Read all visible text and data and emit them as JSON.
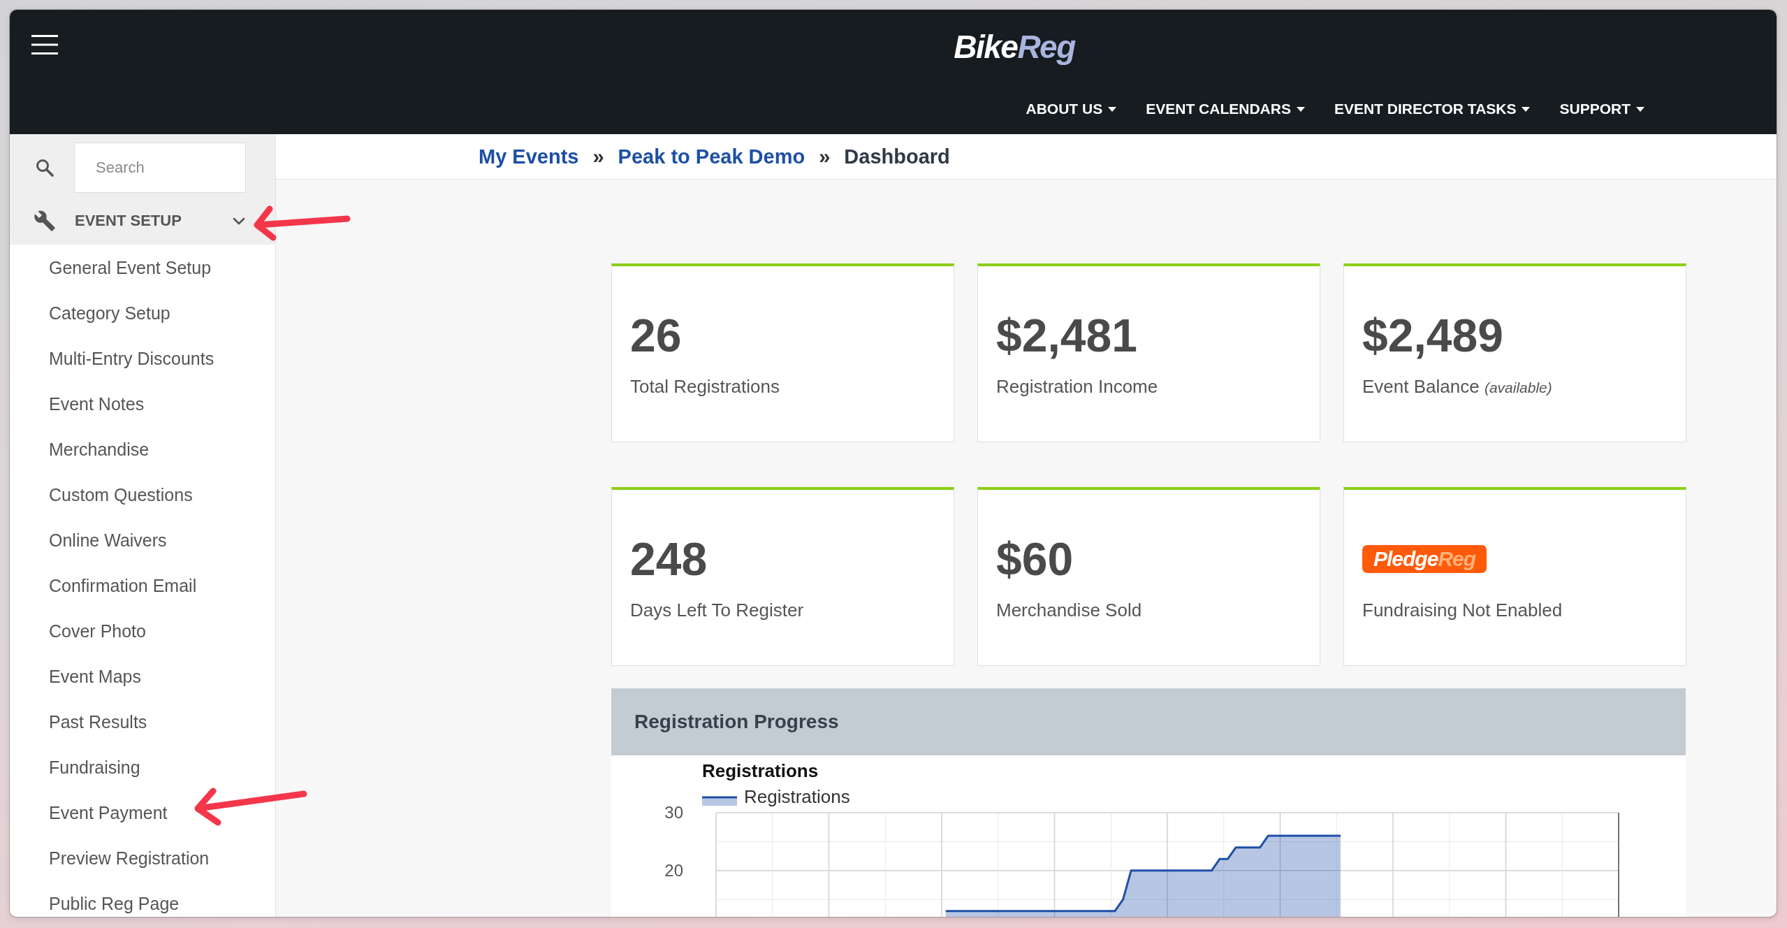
{
  "header": {
    "logo": {
      "lead": "Bike",
      "tail": "Reg"
    },
    "nav": [
      {
        "label": "ABOUT US"
      },
      {
        "label": "EVENT CALENDARS"
      },
      {
        "label": "EVENT DIRECTOR TASKS"
      },
      {
        "label": "SUPPORT"
      }
    ]
  },
  "sidebar": {
    "search": {
      "placeholder": "Search"
    },
    "section": {
      "label": "EVENT SETUP",
      "expanded": true,
      "annotated": true,
      "items": [
        {
          "label": "General Event Setup",
          "annotated": false
        },
        {
          "label": "Category Setup",
          "annotated": false
        },
        {
          "label": "Multi-Entry Discounts",
          "annotated": false
        },
        {
          "label": "Event Notes",
          "annotated": false
        },
        {
          "label": "Merchandise",
          "annotated": false
        },
        {
          "label": "Custom Questions",
          "annotated": false
        },
        {
          "label": "Online Waivers",
          "annotated": false
        },
        {
          "label": "Confirmation Email",
          "annotated": false
        },
        {
          "label": "Cover Photo",
          "annotated": false
        },
        {
          "label": "Event Maps",
          "annotated": false
        },
        {
          "label": "Past Results",
          "annotated": false
        },
        {
          "label": "Fundraising",
          "annotated": false
        },
        {
          "label": "Event Payment",
          "annotated": true
        },
        {
          "label": "Preview Registration",
          "annotated": false
        },
        {
          "label": "Public Reg Page",
          "annotated": false
        }
      ]
    }
  },
  "breadcrumbs": [
    {
      "kind": "link",
      "label": "My Events"
    },
    {
      "kind": "separator",
      "label": "»"
    },
    {
      "kind": "link",
      "label": "Peak to Peak Demo"
    },
    {
      "kind": "separator",
      "label": "»"
    },
    {
      "kind": "current",
      "label": "Dashboard"
    }
  ],
  "cards": [
    {
      "kind": "stat",
      "value": "26",
      "label": "Total Registrations"
    },
    {
      "kind": "stat",
      "value": "$2,481",
      "label": "Registration Income"
    },
    {
      "kind": "stat",
      "value": "$2,489",
      "label": "Event Balance *(available)*"
    },
    {
      "kind": "stat",
      "value": "248",
      "label": "Days Left To Register"
    },
    {
      "kind": "stat",
      "value": "$60",
      "label": "Merchandise Sold"
    },
    {
      "kind": "logo",
      "logo": {
        "lead": "Pledge",
        "tail": "Reg"
      },
      "label": "Fundraising Not Enabled"
    }
  ],
  "progress_panel": {
    "title": "Registration Progress",
    "chart_data": {
      "type": "area",
      "title": "Registrations",
      "categories": [
        null,
        null,
        null,
        null,
        null,
        null,
        null,
        null,
        null,
        null,
        null,
        null,
        null,
        null,
        null,
        null,
        null,
        null,
        null,
        null,
        null,
        null,
        null,
        null,
        null,
        null,
        null,
        null,
        null,
        null,
        null,
        null,
        null,
        null,
        null,
        null,
        null,
        null,
        null,
        null,
        null,
        null,
        null,
        null,
        null,
        null,
        null,
        null,
        null,
        null,
        null,
        null,
        null,
        null,
        null,
        null,
        null,
        null,
        null,
        null,
        null,
        null,
        null,
        null,
        null,
        null,
        null,
        null,
        null,
        null,
        null,
        null,
        null,
        null,
        null,
        null,
        null,
        null,
        null,
        null,
        null,
        null,
        null,
        null,
        null,
        null,
        null,
        null,
        null,
        null,
        null,
        null,
        null,
        null,
        null,
        null,
        null,
        null,
        null,
        null,
        null,
        null,
        null,
        null,
        null,
        null,
        null,
        null,
        null,
        null,
        null,
        null
      ],
      "series": [
        {
          "name": "Registrations",
          "color": "#1f4fa8",
          "values": [
            null,
            null,
            null,
            null,
            null,
            null,
            null,
            null,
            null,
            null,
            null,
            null,
            null,
            null,
            null,
            null,
            null,
            null,
            null,
            null,
            null,
            null,
            null,
            null,
            null,
            null,
            null,
            null,
            13,
            13,
            13,
            13,
            13,
            13,
            13,
            13,
            13,
            13,
            13,
            13,
            13,
            13,
            13,
            13,
            13,
            13,
            13,
            13,
            13,
            13,
            15,
            20,
            20,
            20,
            20,
            20,
            20,
            20,
            20,
            20,
            20,
            20,
            22,
            22,
            24,
            24,
            24,
            24,
            26,
            26,
            26,
            26,
            26,
            26,
            26,
            26,
            26,
            26,
            null,
            null,
            null,
            null,
            null,
            null,
            null,
            null,
            null,
            null,
            null,
            null,
            null,
            null,
            null,
            null,
            null,
            null,
            null,
            null,
            null,
            null,
            null,
            null,
            null,
            null,
            null,
            null,
            null,
            null,
            null,
            null,
            null,
            null
          ]
        }
      ],
      "ylim": [
        12,
        30
      ],
      "yticks": [
        20,
        30
      ]
    }
  }
}
